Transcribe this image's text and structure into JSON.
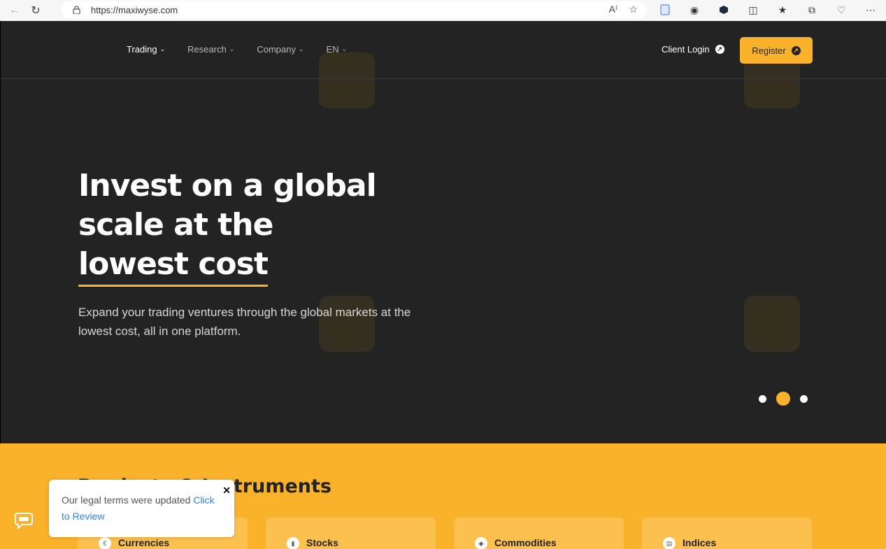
{
  "browser": {
    "url": "https://maxiwyse.com"
  },
  "nav": {
    "menu": [
      {
        "label": "Trading"
      },
      {
        "label": "Research"
      },
      {
        "label": "Company"
      },
      {
        "label": "EN"
      }
    ],
    "client_login": "Client Login",
    "register": "Register"
  },
  "hero": {
    "headline_line1": "Invest on a global",
    "headline_line2": "scale at the",
    "headline_line3": "lowest cost",
    "subtitle": "Expand your trading ventures through the global markets at the lowest cost, all in one platform.",
    "slide_count": 3,
    "active_slide": 2
  },
  "products": {
    "title": "Products & Instruments",
    "cards": [
      {
        "label": "Currencies",
        "icon": "currency-icon"
      },
      {
        "label": "Stocks",
        "icon": "chart-icon"
      },
      {
        "label": "Commodities",
        "icon": "commodity-icon"
      },
      {
        "label": "Indices",
        "icon": "document-icon"
      }
    ]
  },
  "legal_popup": {
    "text": "Our legal terms were updated ",
    "link": "Click to Review"
  },
  "colors": {
    "accent": "#fbb22b",
    "hero_bg": "#232324",
    "link": "#2f80ed"
  }
}
